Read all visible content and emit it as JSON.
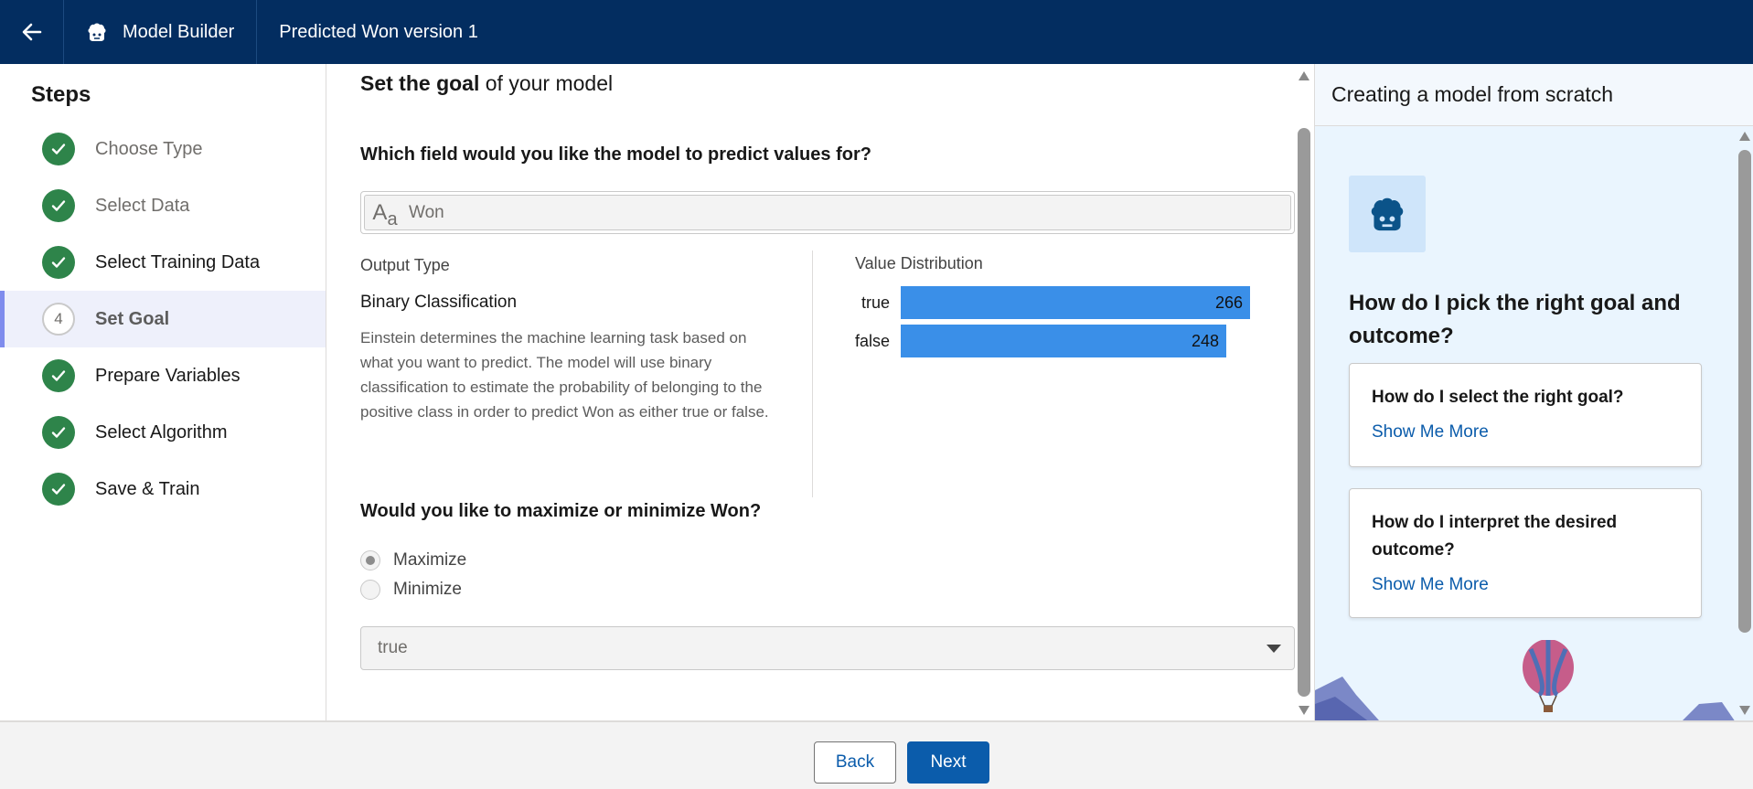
{
  "header": {
    "app_name": "Model Builder",
    "model_title": "Predicted Won version 1"
  },
  "steps": {
    "title": "Steps",
    "items": [
      {
        "label": "Choose Type",
        "status": "complete"
      },
      {
        "label": "Select Data",
        "status": "complete"
      },
      {
        "label": "Select Training Data",
        "status": "complete"
      },
      {
        "label": "Set Goal",
        "status": "current",
        "number": "4"
      },
      {
        "label": "Prepare Variables",
        "status": "complete"
      },
      {
        "label": "Select Algorithm",
        "status": "complete"
      },
      {
        "label": "Save & Train",
        "status": "complete"
      }
    ]
  },
  "main": {
    "title_bold": "Set the goal",
    "title_rest": " of your model",
    "predict_question": "Which field would you like the model to predict values for?",
    "predict_field_value": "Won",
    "output_type_label": "Output Type",
    "output_type_value": "Binary Classification",
    "output_description": "Einstein determines the machine learning task based on what you want to predict. The model will use binary classification to estimate the probability of belonging to the positive class in order to predict Won as either true or false.",
    "distribution_label": "Value Distribution",
    "optimize_question": "Would you like to maximize or minimize Won?",
    "options": [
      {
        "label": "Maximize",
        "selected": true
      },
      {
        "label": "Minimize",
        "selected": false
      }
    ],
    "selected_value": "true"
  },
  "chart_data": {
    "type": "bar",
    "orientation": "horizontal",
    "categories": [
      "true",
      "false"
    ],
    "values": [
      266,
      248
    ],
    "xlim": [
      0,
      266
    ],
    "bar_color": "#3a8fe8"
  },
  "help": {
    "header": "Creating a model from scratch",
    "question": "How do I pick the right goal and outcome?",
    "cards": [
      {
        "title": "How do I select the right goal?",
        "link": "Show Me More"
      },
      {
        "title": "How do I interpret the desired outcome?",
        "link": "Show Me More"
      }
    ]
  },
  "footer": {
    "back_label": "Back",
    "next_label": "Next"
  },
  "colors": {
    "header_bg": "#032d60",
    "step_complete": "#2e844a",
    "primary": "#0b5cab",
    "help_bg": "#eaf5fe"
  }
}
